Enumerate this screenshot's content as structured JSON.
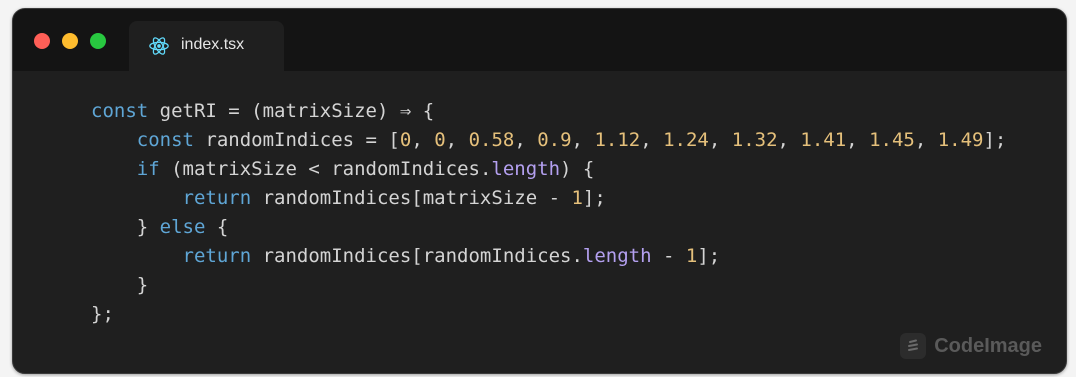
{
  "window": {
    "controls": [
      "close",
      "minimize",
      "maximize"
    ],
    "colors": {
      "close": "#ff5f57",
      "minimize": "#febc2e",
      "maximize": "#28c840"
    }
  },
  "tab": {
    "icon": "react-icon",
    "label": "index.tsx"
  },
  "code": {
    "lines": [
      [
        {
          "t": "kw",
          "v": "const"
        },
        {
          "t": "txt",
          "v": " getRI = (matrixSize) ⇒ {"
        }
      ],
      [
        {
          "t": "txt",
          "v": "    "
        },
        {
          "t": "kw",
          "v": "const"
        },
        {
          "t": "txt",
          "v": " randomIndices = ["
        },
        {
          "t": "num",
          "v": "0"
        },
        {
          "t": "txt",
          "v": ", "
        },
        {
          "t": "num",
          "v": "0"
        },
        {
          "t": "txt",
          "v": ", "
        },
        {
          "t": "num",
          "v": "0.58"
        },
        {
          "t": "txt",
          "v": ", "
        },
        {
          "t": "num",
          "v": "0.9"
        },
        {
          "t": "txt",
          "v": ", "
        },
        {
          "t": "num",
          "v": "1.12"
        },
        {
          "t": "txt",
          "v": ", "
        },
        {
          "t": "num",
          "v": "1.24"
        },
        {
          "t": "txt",
          "v": ", "
        },
        {
          "t": "num",
          "v": "1.32"
        },
        {
          "t": "txt",
          "v": ", "
        },
        {
          "t": "num",
          "v": "1.41"
        },
        {
          "t": "txt",
          "v": ", "
        },
        {
          "t": "num",
          "v": "1.45"
        },
        {
          "t": "txt",
          "v": ", "
        },
        {
          "t": "num",
          "v": "1.49"
        },
        {
          "t": "txt",
          "v": "];"
        }
      ],
      [
        {
          "t": "txt",
          "v": "    "
        },
        {
          "t": "kw",
          "v": "if"
        },
        {
          "t": "txt",
          "v": " (matrixSize < randomIndices."
        },
        {
          "t": "prop",
          "v": "length"
        },
        {
          "t": "txt",
          "v": ") {"
        }
      ],
      [
        {
          "t": "txt",
          "v": "        "
        },
        {
          "t": "kw",
          "v": "return"
        },
        {
          "t": "txt",
          "v": " randomIndices[matrixSize - "
        },
        {
          "t": "num",
          "v": "1"
        },
        {
          "t": "txt",
          "v": "];"
        }
      ],
      [
        {
          "t": "txt",
          "v": "    } "
        },
        {
          "t": "kw",
          "v": "else"
        },
        {
          "t": "txt",
          "v": " {"
        }
      ],
      [
        {
          "t": "txt",
          "v": "        "
        },
        {
          "t": "kw",
          "v": "return"
        },
        {
          "t": "txt",
          "v": " randomIndices[randomIndices."
        },
        {
          "t": "prop",
          "v": "length"
        },
        {
          "t": "txt",
          "v": " - "
        },
        {
          "t": "num",
          "v": "1"
        },
        {
          "t": "txt",
          "v": "];"
        }
      ],
      [
        {
          "t": "txt",
          "v": "    }"
        }
      ],
      [
        {
          "t": "txt",
          "v": "};"
        }
      ]
    ],
    "colors": {
      "keyword": "#5fa6d6",
      "number": "#e5c07b",
      "property": "#b4a0f0",
      "text": "#d4d4d4"
    }
  },
  "watermark": {
    "icon": "codeimage-logo-icon",
    "label": "CodeImage"
  }
}
